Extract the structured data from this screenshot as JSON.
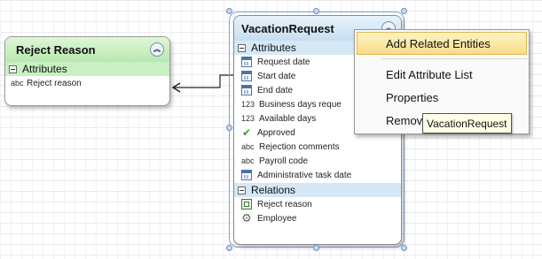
{
  "reject_reason_entity": {
    "title": "Reject Reason",
    "collapse_icon": "double-chevron-up-icon",
    "sections": {
      "attributes": {
        "label": "Attributes",
        "items": [
          {
            "type": "abc",
            "name": "Reject reason"
          }
        ]
      }
    }
  },
  "vacation_request_entity": {
    "title": "VacationRequest",
    "collapse_icon": "double-chevron-up-icon",
    "attributes_label": "Attributes",
    "attributes": [
      {
        "type_text": "",
        "icon": "calendar-icon",
        "name": "Request date"
      },
      {
        "type_text": "",
        "icon": "calendar-icon",
        "name": "Start date"
      },
      {
        "type_text": "",
        "icon": "calendar-icon",
        "name": "End date"
      },
      {
        "type_text": "123",
        "icon": "",
        "name": "Business days reque"
      },
      {
        "type_text": "123",
        "icon": "",
        "name": "Available days"
      },
      {
        "type_text": "",
        "icon": "checkmark-icon",
        "name": "Approved"
      },
      {
        "type_text": "abc",
        "icon": "",
        "name": "Rejection comments"
      },
      {
        "type_text": "abc",
        "icon": "",
        "name": "Payroll code"
      },
      {
        "type_text": "",
        "icon": "calendar-icon",
        "name": "Administrative task date"
      }
    ],
    "relations_label": "Relations",
    "relations": [
      {
        "icon": "relation-icon",
        "name": "Reject reason"
      },
      {
        "icon": "gear-icon",
        "name": "Employee"
      }
    ]
  },
  "context_menu": {
    "items": [
      {
        "label": "Add Related Entities",
        "highlighted": true
      },
      {
        "label": "Edit Attribute List",
        "highlighted": false
      },
      {
        "label": "Properties",
        "highlighted": false
      },
      {
        "label": "Remov",
        "highlighted": false
      }
    ]
  },
  "tooltip": {
    "text": "VacationRequest"
  },
  "colors": {
    "reject_header": "#c9f0c2",
    "vacation_header": "#d5e8f5",
    "menu_highlight": "#f8dd88",
    "tooltip_bg": "#ffffe6",
    "selection_handle": "#6d8fc4"
  }
}
